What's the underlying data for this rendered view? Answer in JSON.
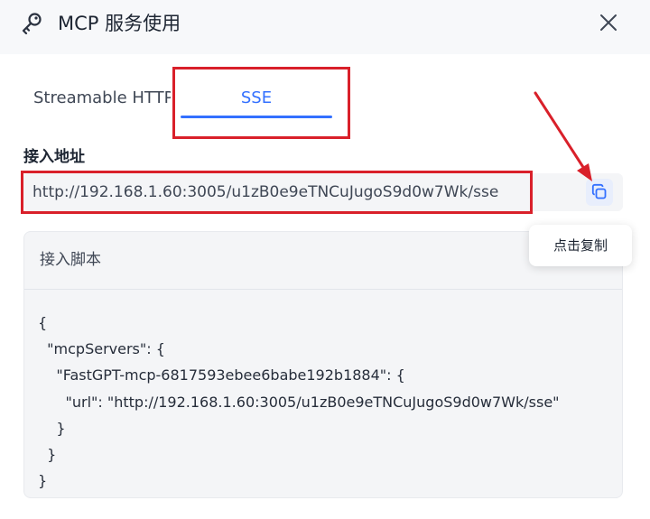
{
  "dialog": {
    "title": "MCP 服务使用",
    "icons": {
      "header": "key-icon",
      "close": "close-icon",
      "copy": "copy-icon"
    }
  },
  "tabs": [
    {
      "label": "Streamable HTTP",
      "active": false
    },
    {
      "label": "SSE",
      "active": true
    }
  ],
  "endpoint": {
    "label": "接入地址",
    "url": "http://192.168.1.60:3005/u1zB0e9eTNCuJugoS9d0w7Wk/sse",
    "copy_tooltip": "点击复制"
  },
  "script": {
    "title": "接入脚本",
    "lines": [
      "{",
      "  \"mcpServers\": {",
      "    \"FastGPT-mcp-6817593ebee6babe192b1884\": {",
      "      \"url\": \"http://192.168.1.60:3005/u1zB0e9eTNCuJugoS9d0w7Wk/sse\"",
      "    }",
      "  }",
      "}"
    ]
  },
  "colors": {
    "accent": "#3370ff",
    "annotation": "#d9202a",
    "header_bg": "#f7f8fa",
    "panel_bg": "#f4f5f7"
  }
}
